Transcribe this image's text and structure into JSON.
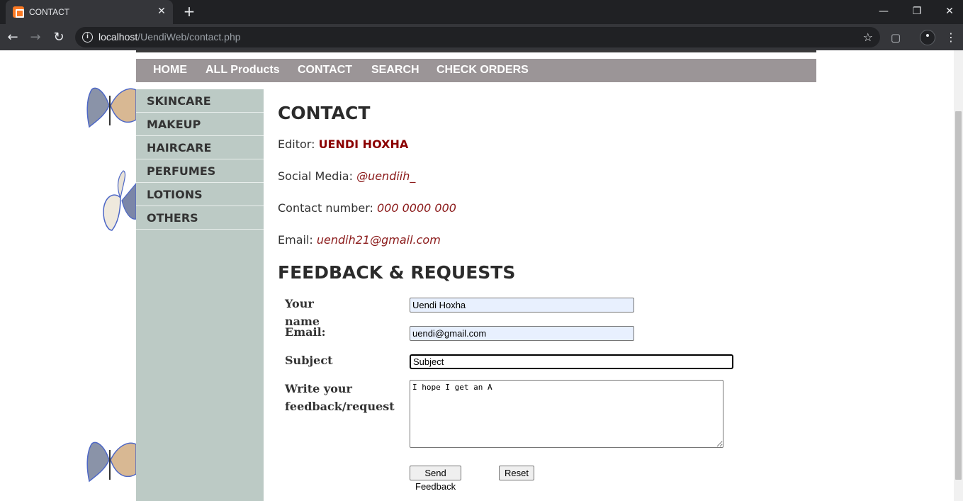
{
  "browser": {
    "tab_title": "CONTACT",
    "tab_close": "✕",
    "new_tab": "+",
    "url_host": "localhost",
    "url_path": "/UendiWeb/contact.php",
    "info_glyph": "i"
  },
  "nav": {
    "items": [
      "HOME",
      "ALL Products",
      "CONTACT",
      "SEARCH",
      "CHECK ORDERS"
    ]
  },
  "sidebar": {
    "items": [
      "SKINCARE",
      "MAKEUP",
      "HAIRCARE",
      "PERFUMES",
      "LOTIONS",
      "OTHERS"
    ]
  },
  "contact": {
    "title": "CONTACT",
    "editor_label": "Editor:",
    "editor_value": "UENDI HOXHA",
    "social_label": "Social Media:",
    "social_value": "@uendiih_",
    "phone_label": "Contact number:",
    "phone_value": "000 0000 000",
    "email_label": "Email:",
    "email_value": "uendih21@gmail.com"
  },
  "feedback": {
    "title": "FEEDBACK & REQUESTS",
    "name_label": "Your name",
    "name_value": "Uendi Hoxha",
    "email_label": "Email:",
    "email_value": "uendi@gmail.com",
    "subject_label": "Subject",
    "subject_value": "Subject",
    "message_label_line1": "Write your",
    "message_label_line2": "feedback/request",
    "message_value": "I hope I get an A",
    "send_label": "Send Feedback",
    "reset_label": "Reset"
  }
}
